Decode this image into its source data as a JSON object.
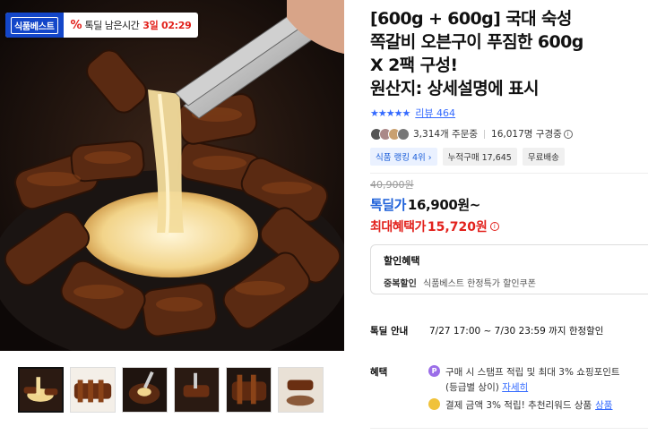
{
  "banner": {
    "brand": "식품베스트",
    "percent_glyph": "%",
    "remaining_label": "톡딜 남은시간",
    "remaining_time": "3일 02:29"
  },
  "product": {
    "title_line1": "[600g + 600g] 국대 숙성",
    "title_line2": "쪽갈비 오븐구이 푸짐한 600g",
    "title_line3": "X 2팩 구성!",
    "title_line4": "원산지: 상세설명에 표시",
    "stars": "★★★★★",
    "review_link": "리뷰 464",
    "orders": "3,314개 주문중",
    "wishes": "16,017명 구경중",
    "info_glyph": "i",
    "rank_badge": "식품 랭킹 4위 ›",
    "cumulative_badge": "누적구매 17,645",
    "shipping_badge": "무료배송"
  },
  "price": {
    "original": "40,900원",
    "deal_label": "톡딜가",
    "deal_price": "16,900원~",
    "max_label": "최대혜택가",
    "max_price": "15,720원",
    "max_info_glyph": "i"
  },
  "discount": {
    "title": "할인혜택",
    "line_label": "중복할인",
    "line_text": "식품베스트 한정특가 할인쿠폰"
  },
  "deal_info": {
    "label": "톡딜 안내",
    "text": "7/27 17:00 ~ 7/30 23:59 까지 한정할인"
  },
  "benefit": {
    "label": "혜택",
    "item1": "구매 시 스탬프 적립 및 최대 3% 쇼핑포인트",
    "item1_icon": "P",
    "item1_sub": "(등급별 상이)",
    "item1_link": "자세히",
    "item2": "결제 금액 3% 적립! 추천리워드 상품",
    "item2_link": "상품"
  },
  "colors": {
    "brand_blue": "#1346c9",
    "link_blue": "#346aff",
    "sale_red": "#e2211c"
  },
  "icons": {
    "rating": "star-icon",
    "info": "info-circle-icon",
    "point": "point-coin-icon",
    "reward": "reward-coin-icon"
  },
  "gallery": {
    "thumbnail_count": 6,
    "active_index": 0
  }
}
